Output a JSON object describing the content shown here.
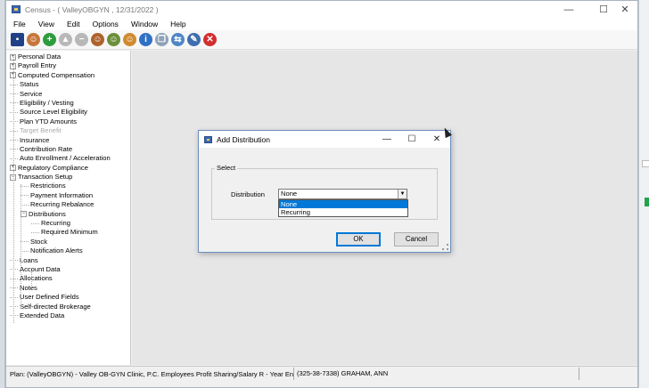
{
  "window": {
    "title": "Census -  ( ValleyOBGYN , 12/31/2022 )",
    "controls": [
      "—",
      "☐",
      "✕"
    ]
  },
  "menu": [
    "File",
    "View",
    "Edit",
    "Options",
    "Window",
    "Help"
  ],
  "toolbar_icons": [
    {
      "name": "save-icon",
      "color": "#1f3f86",
      "glyph": "▪"
    },
    {
      "name": "user-icon",
      "color": "#c9763a",
      "glyph": "☺"
    },
    {
      "name": "add-icon",
      "color": "#2e9c3c",
      "glyph": "+"
    },
    {
      "name": "up-icon",
      "color": "#b8b8b8",
      "glyph": "▲"
    },
    {
      "name": "remove-icon",
      "color": "#b8b8b8",
      "glyph": "−"
    },
    {
      "name": "users-icon",
      "color": "#b0612c",
      "glyph": "☺"
    },
    {
      "name": "find-user-icon",
      "color": "#6b8f3a",
      "glyph": "☺"
    },
    {
      "name": "person-icon",
      "color": "#d08a2f",
      "glyph": "☺"
    },
    {
      "name": "info-icon",
      "color": "#2f6fc4",
      "glyph": "i"
    },
    {
      "name": "copy-icon",
      "color": "#8ea2b8",
      "glyph": "❐"
    },
    {
      "name": "transfer-icon",
      "color": "#4f86c6",
      "glyph": "⇆"
    },
    {
      "name": "edit-icon",
      "color": "#3f6fb0",
      "glyph": "✎"
    },
    {
      "name": "close-icon",
      "color": "#d32f2f",
      "glyph": "✕"
    }
  ],
  "tree": [
    {
      "label": "Personal Data",
      "level": 0,
      "expander": "+"
    },
    {
      "label": "Payroll Entry",
      "level": 0,
      "expander": "+"
    },
    {
      "label": "Computed Compensation",
      "level": 0,
      "expander": "+"
    },
    {
      "label": "Status",
      "level": 0
    },
    {
      "label": "Service",
      "level": 0
    },
    {
      "label": "Eligibility / Vesting",
      "level": 0
    },
    {
      "label": "Source Level Eligibility",
      "level": 0
    },
    {
      "label": "Plan YTD Amounts",
      "level": 0
    },
    {
      "label": "Target Benefit",
      "level": 0,
      "disabled": true
    },
    {
      "label": "Insurance",
      "level": 0
    },
    {
      "label": "Contribution Rate",
      "level": 0
    },
    {
      "label": "Auto Enrollment / Acceleration",
      "level": 0
    },
    {
      "label": "Regulatory Compliance",
      "level": 0,
      "expander": "+"
    },
    {
      "label": "Transaction Setup",
      "level": 0,
      "expander": "−"
    },
    {
      "label": "Restrictions",
      "level": 1
    },
    {
      "label": "Payment Information",
      "level": 1
    },
    {
      "label": "Recurring Rebalance",
      "level": 1
    },
    {
      "label": "Distributions",
      "level": 1,
      "expander": "−"
    },
    {
      "label": "Recurring",
      "level": 2
    },
    {
      "label": "Required Minimum",
      "level": 2
    },
    {
      "label": "Stock",
      "level": 1
    },
    {
      "label": "Notification Alerts",
      "level": 1
    },
    {
      "label": "Loans",
      "level": 0
    },
    {
      "label": "Account Data",
      "level": 0
    },
    {
      "label": "Allocations",
      "level": 0
    },
    {
      "label": "Notes",
      "level": 0
    },
    {
      "label": "User Defined Fields",
      "level": 0
    },
    {
      "label": "Self-directed Brokerage",
      "level": 0
    },
    {
      "label": "Extended Data",
      "level": 0
    }
  ],
  "dialog": {
    "title": "Add Distribution",
    "controls": [
      "—",
      "☐",
      "✕"
    ],
    "group_label": "Select",
    "field_label": "Distribution",
    "selected": "None",
    "options": [
      "None",
      "Recurring"
    ],
    "ok_label": "OK",
    "cancel_label": "Cancel"
  },
  "status": {
    "plan": "Plan: (ValleyOBGYN) - Valley OB-GYN Clinic, P.C. Employees Profit Sharing/Salary R - Year End",
    "employee": "(325-38-7338) GRAHAM, ANN"
  }
}
